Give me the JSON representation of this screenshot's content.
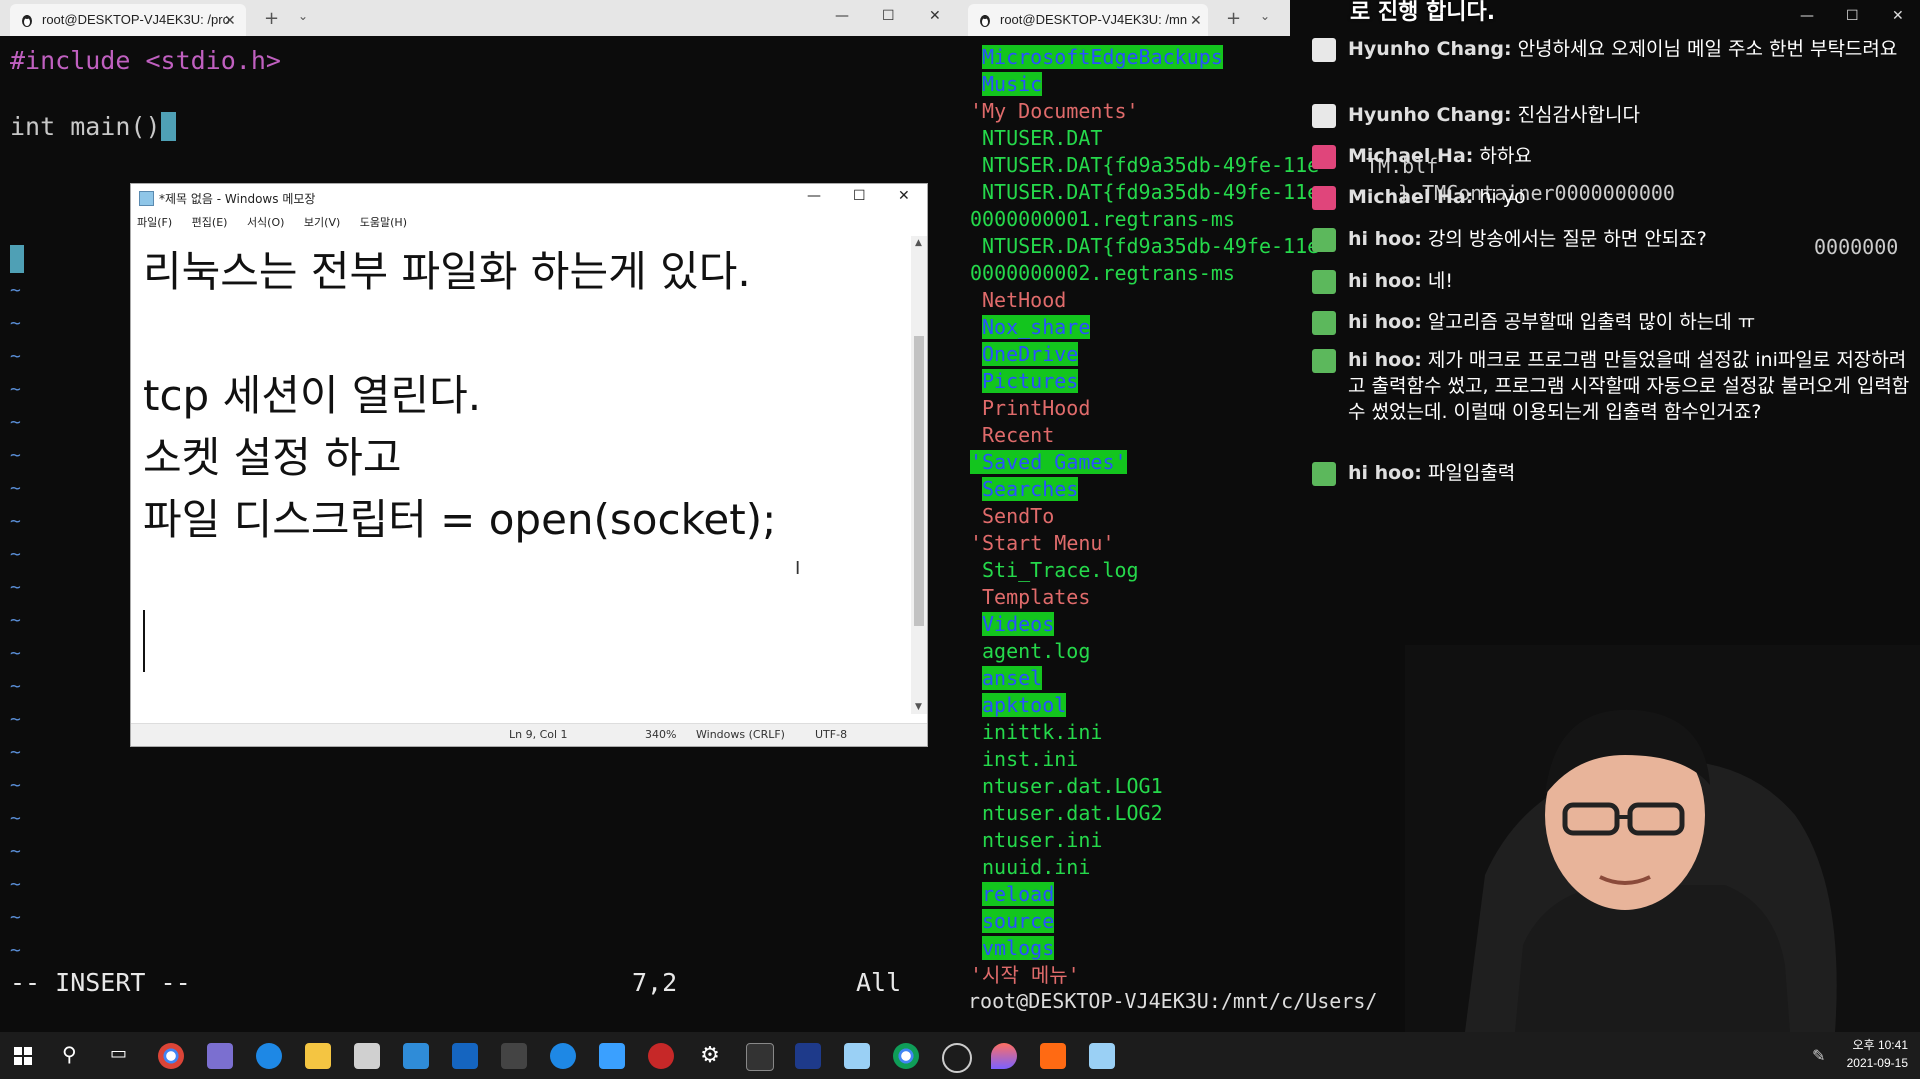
{
  "left_terminal": {
    "tab_title": "root@DESKTOP-VJ4EK3U: /pro",
    "code_line1": "#include <stdio.h>",
    "code_line2": "int main()",
    "status_mode": "-- INSERT --",
    "status_pos": "7,2",
    "status_all": "All"
  },
  "notepad": {
    "title": "*제목 없음 - Windows 메모장",
    "menu": [
      "파일(F)",
      "편집(E)",
      "서식(O)",
      "보기(V)",
      "도움말(H)"
    ],
    "lines": [
      "리눅스는 전부 파일화 하는게 있다.",
      "tcp 세션이 열린다.",
      "소켓 설정 하고",
      "파일 디스크립터 = open(socket);"
    ],
    "status_ln": "Ln 9, Col 1",
    "status_zoom": "340%",
    "status_eol": "Windows (CRLF)",
    "status_enc": "UTF-8"
  },
  "right_terminal": {
    "tab_title": "root@DESKTOP-VJ4EK3U: /mn",
    "listing": [
      {
        "text": "MicrosoftEdgeBackups",
        "kind": "dir"
      },
      {
        "text": "Music",
        "kind": "dir"
      },
      {
        "text": "'My Documents'",
        "kind": "red"
      },
      {
        "text": "NTUSER.DAT",
        "kind": "green"
      },
      {
        "text": "NTUSER.DAT{fd9a35db-49fe-11e",
        "kind": "green"
      },
      {
        "text": "NTUSER.DAT{fd9a35db-49fe-11e",
        "kind": "green"
      },
      {
        "text": "0000000001.regtrans-ms",
        "kind": "green"
      },
      {
        "text": "NTUSER.DAT{fd9a35db-49fe-11e",
        "kind": "green"
      },
      {
        "text": "0000000002.regtrans-ms",
        "kind": "green"
      },
      {
        "text": "NetHood",
        "kind": "red"
      },
      {
        "text": "Nox_share",
        "kind": "dir"
      },
      {
        "text": "OneDrive",
        "kind": "dir"
      },
      {
        "text": "Pictures",
        "kind": "dir"
      },
      {
        "text": "PrintHood",
        "kind": "red"
      },
      {
        "text": "Recent",
        "kind": "red"
      },
      {
        "text": "'Saved Games'",
        "kind": "dir"
      },
      {
        "text": "Searches",
        "kind": "dir"
      },
      {
        "text": "SendTo",
        "kind": "red"
      },
      {
        "text": "'Start Menu'",
        "kind": "red"
      },
      {
        "text": "Sti_Trace.log",
        "kind": "green"
      },
      {
        "text": "Templates",
        "kind": "red"
      },
      {
        "text": "Videos",
        "kind": "dir"
      },
      {
        "text": "agent.log",
        "kind": "green"
      },
      {
        "text": "ansel",
        "kind": "dir"
      },
      {
        "text": "apktool",
        "kind": "dir"
      },
      {
        "text": "inittk.ini",
        "kind": "green"
      },
      {
        "text": "inst.ini",
        "kind": "green"
      },
      {
        "text": "ntuser.dat.LOG1",
        "kind": "green"
      },
      {
        "text": "ntuser.dat.LOG2",
        "kind": "green"
      },
      {
        "text": "ntuser.ini",
        "kind": "green"
      },
      {
        "text": "nuuid.ini",
        "kind": "green"
      },
      {
        "text": "reload",
        "kind": "dir"
      },
      {
        "text": "source",
        "kind": "dir"
      },
      {
        "text": "vmlogs",
        "kind": "dir"
      },
      {
        "text": "'시작 메뉴'",
        "kind": "red"
      }
    ],
    "ntuser_tail_1": "TM.blf",
    "ntuser_tail_2": "}.TMContainer0000000000",
    "ntuser_tail_3": "0000000",
    "prompt": "root@DESKTOP-VJ4EK3U:/mnt/c/Users/"
  },
  "chat": {
    "top_partial": "로 진행 합니다.",
    "messages": [
      {
        "name": "Hyunho Chang:",
        "text": "안녕하세요 오제이님 메일 주소 한번 부탁드려요"
      },
      {
        "name": "Hyunho Chang:",
        "text": "진심감사합니다"
      },
      {
        "name": "Michael Ha:",
        "text": "하하요"
      },
      {
        "name": "Michael Ha:",
        "text": "hi yo"
      },
      {
        "name": "hi hoo:",
        "text": "강의 방송에서는 질문 하면 안되죠?"
      },
      {
        "name": "hi hoo:",
        "text": "네!"
      },
      {
        "name": "hi hoo:",
        "text": "알고리즘 공부할때 입출력 많이 하는데 ㅠ"
      },
      {
        "name": "hi hoo:",
        "text": "제가 매크로 프로그램 만들었을때 설정값 ini파일로 저장하려고 출력함수 썼고, 프로그램 시작할때 자동으로 설정값 불러오게 입력함수 썼었는데. 이럴때 이용되는게 입출력 함수인거죠?"
      },
      {
        "name": "hi hoo:",
        "text": "파일입출력"
      }
    ]
  },
  "taskbar": {
    "time": "오후 10:41",
    "date": "2021-09-15"
  }
}
